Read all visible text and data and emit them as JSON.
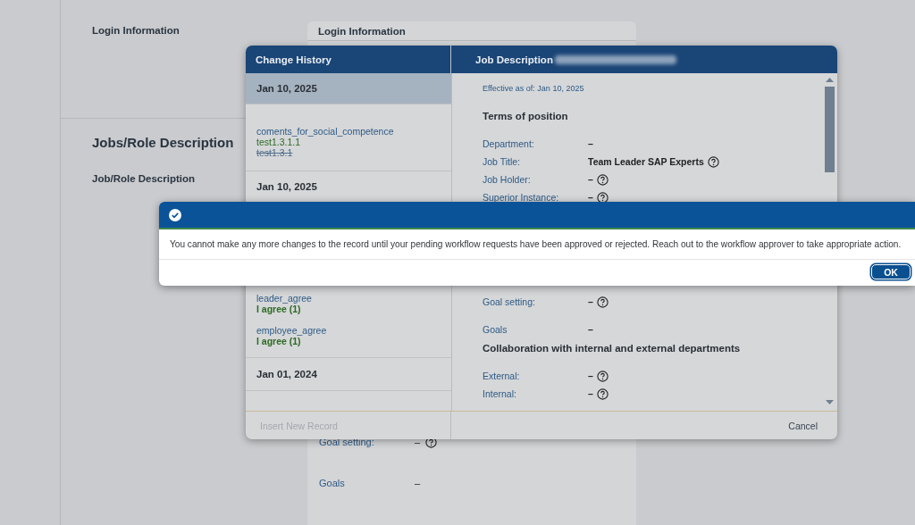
{
  "page": {
    "login_title": "Login Information",
    "jobs_heading": "Jobs/Role Description",
    "jobs_title": "Job/Role Description"
  },
  "background_card": {
    "title": "Login Information",
    "fields": [
      {
        "label": "Goal setting:",
        "value": "–",
        "help": true
      },
      {
        "label": "Goals",
        "value": "–",
        "help": false
      }
    ]
  },
  "dialog": {
    "history_title": "Change History",
    "detail_title": "Job Description",
    "history_above": [
      {
        "kind": "date",
        "text": "Jan 10, 2025",
        "selected": true
      },
      {
        "kind": "change",
        "field": "coments_for_social_competence",
        "lines": [
          {
            "text": "test1.3.1.1",
            "struck": false,
            "bold": false
          },
          {
            "text": "test1.3.1",
            "struck": true,
            "bold": false
          }
        ]
      },
      {
        "kind": "date",
        "text": "Jan 10, 2025",
        "selected": false
      }
    ],
    "history_below": [
      {
        "kind": "change",
        "field": "leader_agree",
        "lines": [
          {
            "text": "I agree (1)",
            "struck": false,
            "bold": true
          }
        ]
      },
      {
        "kind": "change",
        "field": "employee_agree",
        "lines": [
          {
            "text": "I agree (1)",
            "struck": false,
            "bold": true
          }
        ]
      },
      {
        "kind": "date",
        "text": "Jan 01, 2024",
        "selected": false
      }
    ],
    "detail_above": [
      {
        "kind": "effective",
        "text": "Effective as of: Jan 10, 2025"
      },
      {
        "kind": "heading",
        "text": "Terms of position"
      },
      {
        "kind": "field",
        "label": "Department:",
        "value": "–",
        "help": false
      },
      {
        "kind": "field",
        "label": "Job Title:",
        "value": "Team Leader SAP Experts",
        "help": true
      },
      {
        "kind": "field",
        "label": "Job Holder:",
        "value": "–",
        "help": true
      },
      {
        "kind": "field",
        "label": "Superior Instance:",
        "value": "–",
        "help": true
      }
    ],
    "detail_below": [
      {
        "kind": "field",
        "label": "Goal setting:",
        "value": "–",
        "help": true
      },
      {
        "kind": "field",
        "label": "Goals",
        "value": "–",
        "help": false
      },
      {
        "kind": "heading",
        "text": "Collaboration with internal and external departments"
      },
      {
        "kind": "field",
        "label": "External:",
        "value": "–",
        "help": true
      },
      {
        "kind": "field",
        "label": "Internal:",
        "value": "–",
        "help": true
      }
    ],
    "insert_button": {
      "label": "Insert New Record",
      "disabled": true
    },
    "cancel_button": "Cancel"
  },
  "alert": {
    "message": "You cannot make any more changes to the record until your pending workflow requests have been approved or rejected. Reach out to the workflow approver to take appropriate action.",
    "ok": "OK"
  }
}
